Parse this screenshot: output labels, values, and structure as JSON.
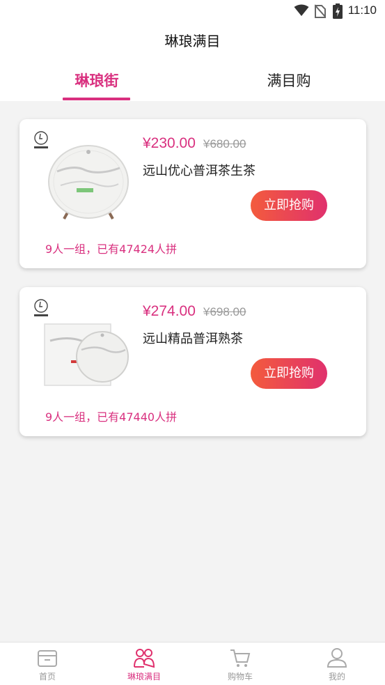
{
  "status_bar": {
    "time": "11:10",
    "icons": [
      "wifi-icon",
      "no-sim-icon",
      "battery-icon"
    ]
  },
  "header": {
    "title": "琳琅满目"
  },
  "tabs": [
    {
      "label": "琳琅街",
      "active": true
    },
    {
      "label": "满目购",
      "active": false
    }
  ],
  "products": [
    {
      "price": "¥230.00",
      "old_price": "¥680.00",
      "name": "远山优心普洱茶生茶",
      "buy_label": "立即抢购",
      "group_text": "9人一组，已有47424人拼",
      "image": "tea-cake-on-stand"
    },
    {
      "price": "¥274.00",
      "old_price": "¥698.00",
      "name": "远山精品普洱熟茶",
      "buy_label": "立即抢购",
      "group_text": "9人一组，已有47440人拼",
      "image": "tea-cake-with-box"
    }
  ],
  "tabbar": [
    {
      "label": "首页",
      "icon": "home-box-icon",
      "active": false
    },
    {
      "label": "琳琅满目",
      "icon": "group-people-icon",
      "active": true
    },
    {
      "label": "购物车",
      "icon": "cart-icon",
      "active": false
    },
    {
      "label": "我的",
      "icon": "user-icon",
      "active": false
    }
  ],
  "colors": {
    "accent": "#d9307f",
    "button_start": "#f35b3d",
    "button_end": "#e0316d",
    "background": "#f3f3f3"
  }
}
